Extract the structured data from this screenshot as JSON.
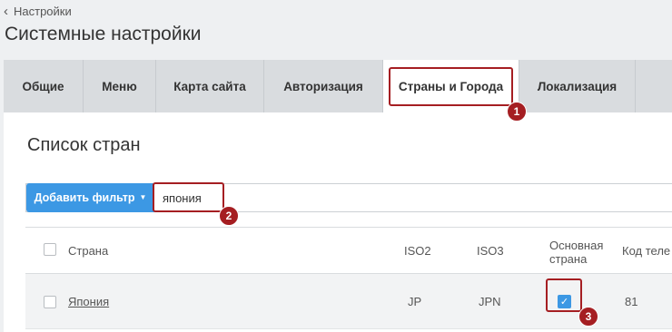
{
  "breadcrumb": {
    "back_label": "Настройки"
  },
  "page": {
    "title": "Системные настройки"
  },
  "tabs": [
    {
      "label": "Общие",
      "active": false
    },
    {
      "label": "Меню",
      "active": false
    },
    {
      "label": "Карта сайта",
      "active": false
    },
    {
      "label": "Авторизация",
      "active": false
    },
    {
      "label": "Страны и Города",
      "active": true
    },
    {
      "label": "Локализация",
      "active": false
    }
  ],
  "section": {
    "title": "Список стран"
  },
  "filter": {
    "button_label": "Добавить фильтр",
    "value": "япония"
  },
  "table": {
    "headers": {
      "country": "Страна",
      "iso2": "ISO2",
      "iso3": "ISO3",
      "main_country_line1": "Основная",
      "main_country_line2": "страна",
      "phone_code": "Код теле"
    },
    "rows": [
      {
        "country": "Япония",
        "iso2": "JP",
        "iso3": "JPN",
        "main_country": true,
        "phone_code": "81"
      }
    ]
  },
  "step_markers": [
    "1",
    "2",
    "3"
  ],
  "colors": {
    "accent": "#3c98e4",
    "annotation": "#a51e22",
    "link": "#2f86c6"
  }
}
